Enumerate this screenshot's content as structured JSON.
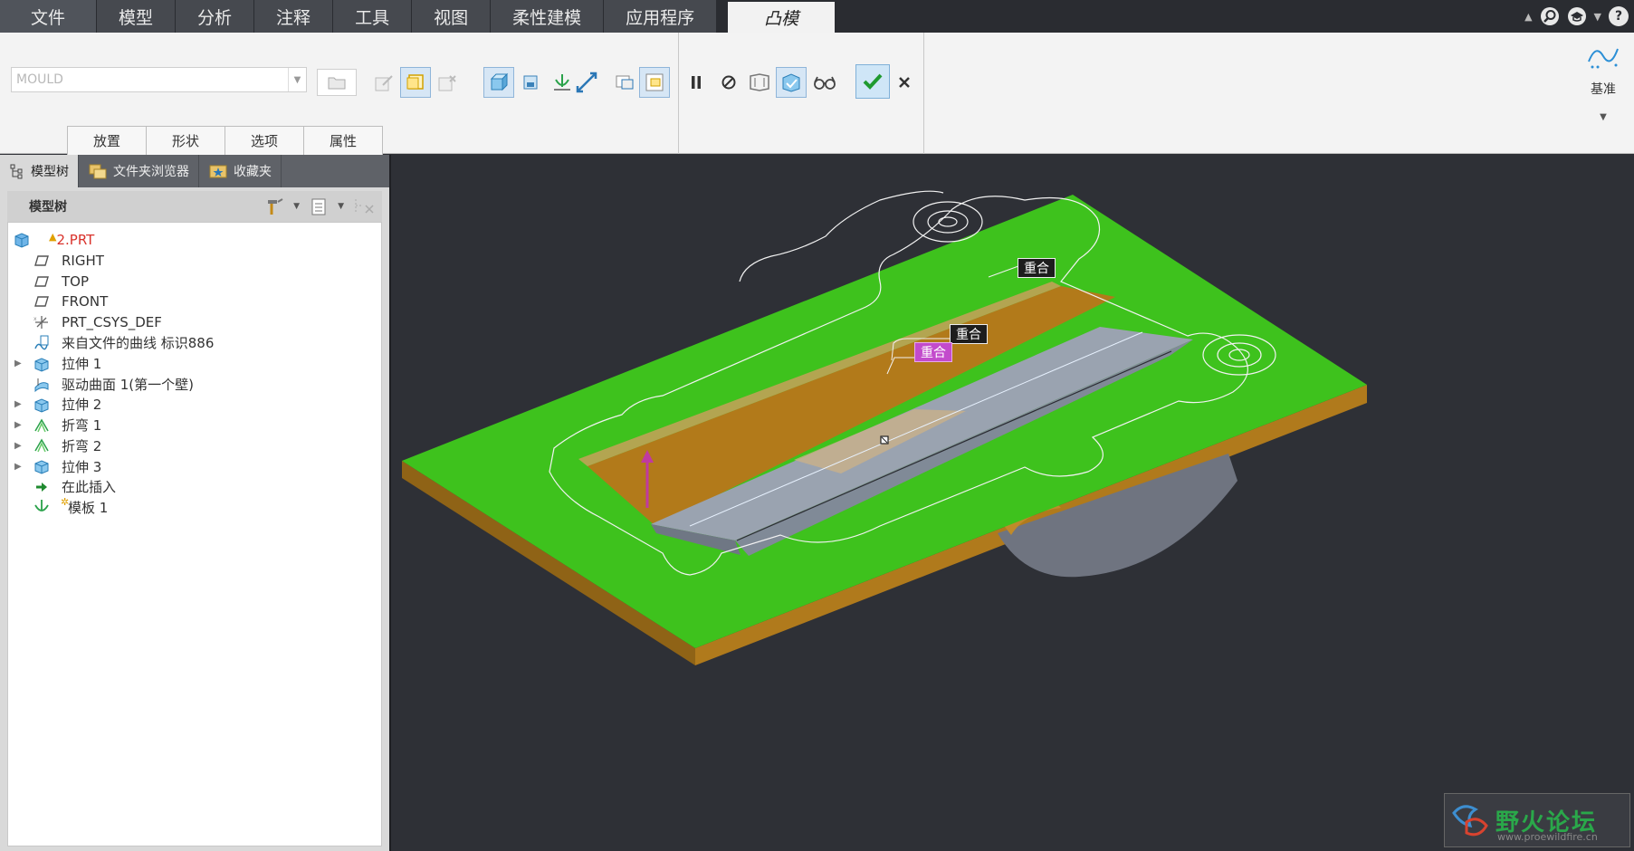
{
  "menu": {
    "tabs": [
      "文件",
      "模型",
      "分析",
      "注释",
      "工具",
      "视图",
      "柔性建模",
      "应用程序"
    ],
    "active_tab": "凸模"
  },
  "ribbon": {
    "combo_placeholder": "MOULD",
    "subtabs": [
      "放置",
      "形状",
      "选项",
      "属性"
    ],
    "datum_label": "基准"
  },
  "panel": {
    "tabs": [
      "模型树",
      "文件夹浏览器",
      "收藏夹"
    ],
    "tree_title": "模型树"
  },
  "tree": {
    "root": "2.PRT",
    "items": [
      {
        "label": "RIGHT",
        "icon": "datum-plane-icon",
        "expandable": false
      },
      {
        "label": "TOP",
        "icon": "datum-plane-icon",
        "expandable": false
      },
      {
        "label": "FRONT",
        "icon": "datum-plane-icon",
        "expandable": false
      },
      {
        "label": "PRT_CSYS_DEF",
        "icon": "csys-icon",
        "expandable": false
      },
      {
        "label": "来自文件的曲线 标识886",
        "icon": "curve-icon",
        "expandable": false
      },
      {
        "label": "拉伸 1",
        "icon": "extrude-icon",
        "expandable": true
      },
      {
        "label": "驱动曲面 1(第一个壁)",
        "icon": "surface-icon",
        "expandable": false
      },
      {
        "label": "拉伸 2",
        "icon": "extrude-icon",
        "expandable": true
      },
      {
        "label": "折弯 1",
        "icon": "bend-icon",
        "expandable": true
      },
      {
        "label": "折弯 2",
        "icon": "bend-icon",
        "expandable": true
      },
      {
        "label": "拉伸 3",
        "icon": "extrude-icon",
        "expandable": true
      },
      {
        "label": "在此插入",
        "icon": "insert-arrow-icon",
        "expandable": false
      },
      {
        "label": "模板 1",
        "icon": "punch-icon",
        "expandable": false
      }
    ]
  },
  "viewport": {
    "callouts": [
      "重合",
      "重合",
      "重合"
    ],
    "watermark_text": "野火论坛",
    "watermark_url": "www.proewildfire.cn"
  },
  "colors": {
    "face_green": "#3ec21d",
    "side_orange": "#b07a1c",
    "punch_gray": "#9aa3b0",
    "callout_pink": "#c34bcc",
    "arrow_magenta": "#c03aa0"
  }
}
